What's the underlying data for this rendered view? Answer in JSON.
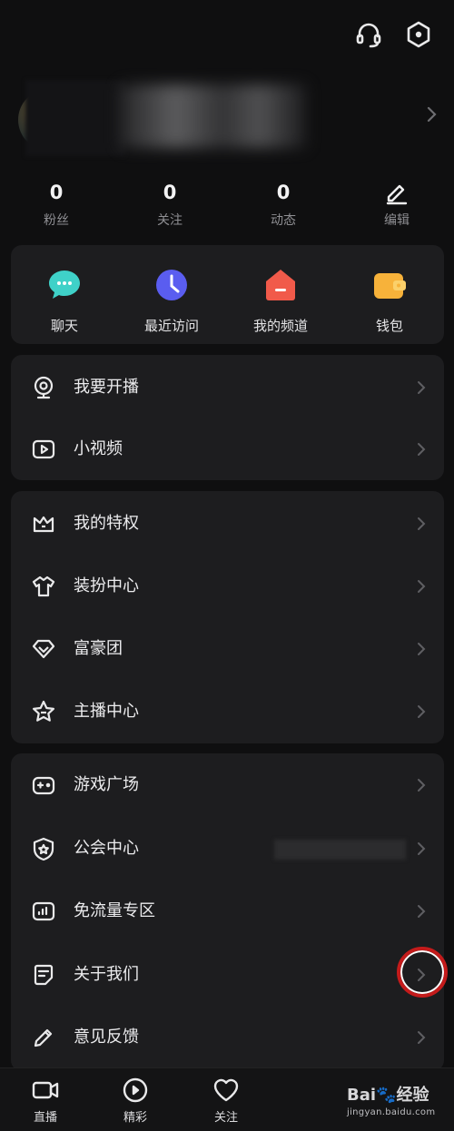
{
  "stats": [
    {
      "value": "0",
      "label": "粉丝"
    },
    {
      "value": "0",
      "label": "关注"
    },
    {
      "value": "0",
      "label": "动态"
    }
  ],
  "edit_label": "编辑",
  "quick": [
    {
      "label": "聊天",
      "icon": "chat-bubble-icon",
      "color": "#3fd1c8"
    },
    {
      "label": "最近访问",
      "icon": "clock-icon",
      "color": "#5a5df0"
    },
    {
      "label": "我的频道",
      "icon": "home-icon",
      "color": "#f15a4a"
    },
    {
      "label": "钱包",
      "icon": "wallet-icon",
      "color": "#f7b23a"
    }
  ],
  "group1": [
    {
      "label": "我要开播",
      "icon": "webcam-icon"
    },
    {
      "label": "小视频",
      "icon": "play-video-icon"
    }
  ],
  "group2": [
    {
      "label": "我的特权",
      "icon": "crown-icon"
    },
    {
      "label": "装扮中心",
      "icon": "tshirt-icon"
    },
    {
      "label": "富豪团",
      "icon": "diamond-icon"
    },
    {
      "label": "主播中心",
      "icon": "star-icon"
    }
  ],
  "group3": [
    {
      "label": "游戏广场",
      "icon": "gamepad-icon"
    },
    {
      "label": "公会中心",
      "icon": "shield-star-icon"
    },
    {
      "label": "免流量专区",
      "icon": "signal-chart-icon"
    },
    {
      "label": "关于我们",
      "icon": "note-icon"
    },
    {
      "label": "意见反馈",
      "icon": "pencil-icon"
    }
  ],
  "tabs": [
    {
      "label": "直播",
      "icon": "video-camera-icon"
    },
    {
      "label": "精彩",
      "icon": "eye-play-icon"
    },
    {
      "label": "关注",
      "icon": "heart-icon"
    }
  ],
  "watermark": {
    "logo": "Bai",
    "logo2": "经验",
    "url": "jingyan.baidu.com"
  }
}
